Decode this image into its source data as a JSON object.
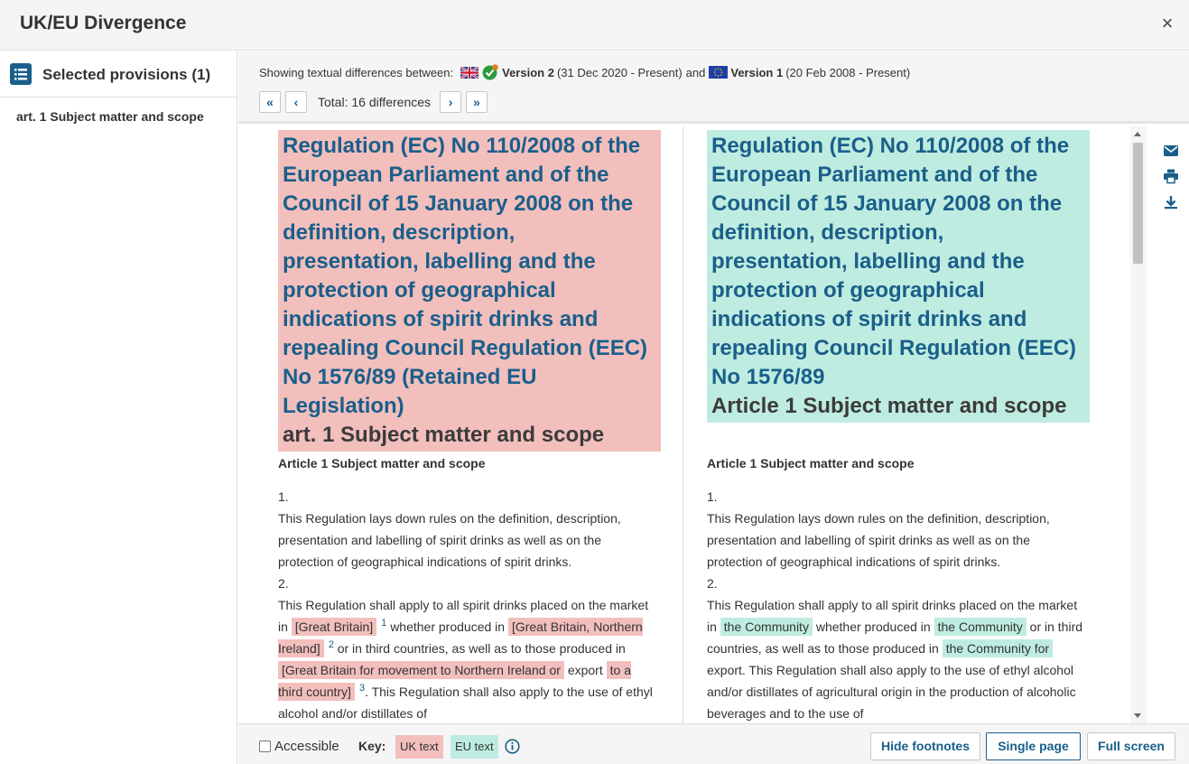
{
  "window": {
    "title": "UK/EU Divergence",
    "close_symbol": "×"
  },
  "sidebar": {
    "title": "Selected provisions (1)",
    "items": [
      {
        "label": "art. 1 Subject matter and scope"
      }
    ]
  },
  "toolbar": {
    "showing_prefix": "Showing textual differences between:",
    "v2_label": "Version 2",
    "v2_dates": "(31 Dec 2020 - Present)",
    "and_text": "and",
    "v1_label": "Version 1",
    "v1_dates": "(20 Feb 2008 - Present)",
    "total_text": "Total: 16 differences",
    "nav": {
      "first": "«",
      "prev": "‹",
      "next": "›",
      "last": "»"
    }
  },
  "uk": {
    "title_lines": [
      "Regulation (EC) No 110/2008 of the",
      "European Parliament and of the",
      "Council of 15 January 2008 on the",
      "definition, description,",
      "presentation, labelling and the",
      "protection of geographical",
      "indications of spirit drinks and",
      "repealing Council Regulation (EEC)",
      "No 1576/89 (Retained EU",
      "Legislation)"
    ],
    "article_title": "art. 1 Subject matter and scope",
    "heading": "Article 1 Subject matter and scope",
    "p1_num": "1.",
    "p1_text": "This Regulation lays down rules on the definition, description, presentation and labelling of spirit drinks as well as on the protection of geographical indications of spirit drinks.",
    "p2_num": "2.",
    "p2_a": "This Regulation shall apply to all spirit drinks placed on the market in",
    "ins1": "[Great Britain]",
    "fn1": "1",
    "p2_b": "whether produced in",
    "ins2": "[Great Britain, Northern Ireland]",
    "fn2": "2",
    "p2_c": "or in third countries, as well as to those produced in",
    "ins3": "[Great Britain for movement to Northern Ireland or",
    "p2_d": "export",
    "ins4": "to a third country]",
    "fn3": "3",
    "p2_e": ". This Regulation shall also apply to the use of ethyl alcohol and/or distillates of"
  },
  "eu": {
    "title_lines": [
      "Regulation (EC) No 110/2008 of the",
      "European Parliament and of the",
      "Council of 15 January 2008 on the",
      "definition, description,",
      "presentation, labelling and the",
      "protection of geographical",
      "indications of spirit drinks and",
      "repealing Council Regulation (EEC)",
      "No 1576/89"
    ],
    "article_title": "Article 1 Subject matter and scope",
    "heading": "Article 1 Subject matter and scope",
    "p1_num": "1.",
    "p1_text": "This Regulation lays down rules on the definition, description, presentation and labelling of spirit drinks as well as on the protection of geographical indications of spirit drinks.",
    "p2_num": "2.",
    "p2_a": "This Regulation shall apply to all spirit drinks placed on the market in",
    "ins1": "the Community",
    "p2_b": "whether produced in",
    "ins2": "the Community",
    "p2_c": "or in third countries, as well as to those produced in",
    "ins3": "the Community for",
    "p2_d": "export. This Regulation shall also apply to the use of ethyl alcohol and/or distillates of agricultural origin in the production of alcoholic beverages and to the use of"
  },
  "footer": {
    "accessible_label": "Accessible",
    "key_label": "Key:",
    "key_uk": "UK text",
    "key_eu": "EU text",
    "buttons": {
      "hide_footnotes": "Hide footnotes",
      "single_page": "Single page",
      "full_screen": "Full screen"
    }
  },
  "colors": {
    "accent": "#1a5f8a",
    "uk_highlight": "#f2bfbd",
    "eu_highlight": "#bfece0"
  }
}
